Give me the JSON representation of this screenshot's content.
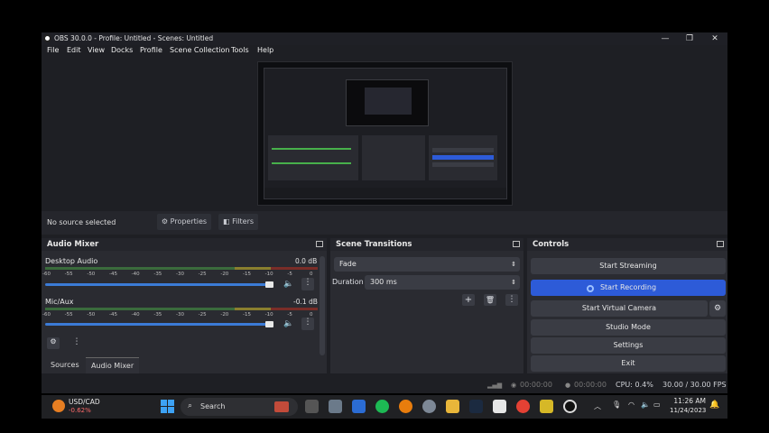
{
  "window": {
    "title": "OBS 30.0.0 - Profile: Untitled - Scenes: Untitled",
    "minimize": "—",
    "maximize": "❐",
    "close": "✕"
  },
  "menu": [
    "File",
    "Edit",
    "View",
    "Docks",
    "Profile",
    "Scene Collection",
    "Tools",
    "Help"
  ],
  "source_bar": {
    "no_source": "No source selected",
    "properties": "Properties",
    "filters": "Filters"
  },
  "audio_mixer": {
    "title": "Audio Mixer",
    "scale": [
      "-60",
      "-55",
      "-50",
      "-45",
      "-40",
      "-35",
      "-30",
      "-25",
      "-20",
      "-15",
      "-10",
      "-5",
      "0"
    ],
    "channels": [
      {
        "name": "Desktop Audio",
        "db": "0.0 dB",
        "level": 0.96
      },
      {
        "name": "Mic/Aux",
        "db": "-0.1 dB",
        "level": 0.96
      }
    ]
  },
  "scene_transitions": {
    "title": "Scene Transitions",
    "transition": "Fade",
    "duration_label": "Duration",
    "duration_value": "300 ms"
  },
  "controls": {
    "title": "Controls",
    "start_streaming": "Start Streaming",
    "start_recording": "Start Recording",
    "start_virtual_camera": "Start Virtual Camera",
    "studio_mode": "Studio Mode",
    "settings": "Settings",
    "exit": "Exit"
  },
  "bottom_tabs": {
    "sources": "Sources",
    "audio_mixer": "Audio Mixer"
  },
  "status": {
    "stream_time": "00:00:00",
    "rec_time": "00:00:00",
    "cpu": "CPU: 0.4%",
    "fps": "30.00 / 30.00 FPS"
  },
  "taskbar": {
    "ticker_symbol": "USD/CAD",
    "ticker_change": "-0.62%",
    "search_placeholder": "Search",
    "time": "11:26 AM",
    "date": "11/24/2023"
  },
  "colors": {
    "accent": "#2d5bd8",
    "meter_green": "#47b04b",
    "meter_yellow": "#c8b83a",
    "meter_red": "#c0392b"
  }
}
